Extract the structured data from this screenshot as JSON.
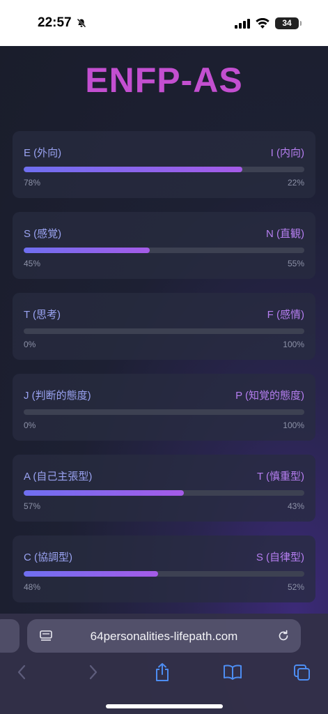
{
  "status": {
    "time": "22:57",
    "battery": "34"
  },
  "page": {
    "title": "ENFP-AS"
  },
  "traits": [
    {
      "left": "E (外向)",
      "right": "I (内向)",
      "left_pct": "78%",
      "right_pct": "22%",
      "value": 78
    },
    {
      "left": "S (感覚)",
      "right": "N (直観)",
      "left_pct": "45%",
      "right_pct": "55%",
      "value": 45
    },
    {
      "left": "T (思考)",
      "right": "F (感情)",
      "left_pct": "0%",
      "right_pct": "100%",
      "value": 0
    },
    {
      "left": "J (判断的態度)",
      "right": "P (知覚的態度)",
      "left_pct": "0%",
      "right_pct": "100%",
      "value": 0
    },
    {
      "left": "A (自己主張型)",
      "right": "T (慎重型)",
      "left_pct": "57%",
      "right_pct": "43%",
      "value": 57
    },
    {
      "left": "C (協調型)",
      "right": "S (自律型)",
      "left_pct": "48%",
      "right_pct": "52%",
      "value": 48
    }
  ],
  "browser": {
    "url": "64personalities-lifepath.com"
  },
  "icons": {
    "status": [
      "silent-bell-icon",
      "signal-icon",
      "wifi-icon",
      "battery-icon"
    ],
    "toolbar": [
      "back-icon",
      "forward-icon",
      "share-icon",
      "bookmarks-icon",
      "tabs-icon"
    ]
  },
  "colors": {
    "title": "#c34fd0",
    "bar_start": "#6f6ff0",
    "bar_end": "#a55be8",
    "label_left": "#9aa3f2",
    "label_right": "#b57ef0"
  }
}
